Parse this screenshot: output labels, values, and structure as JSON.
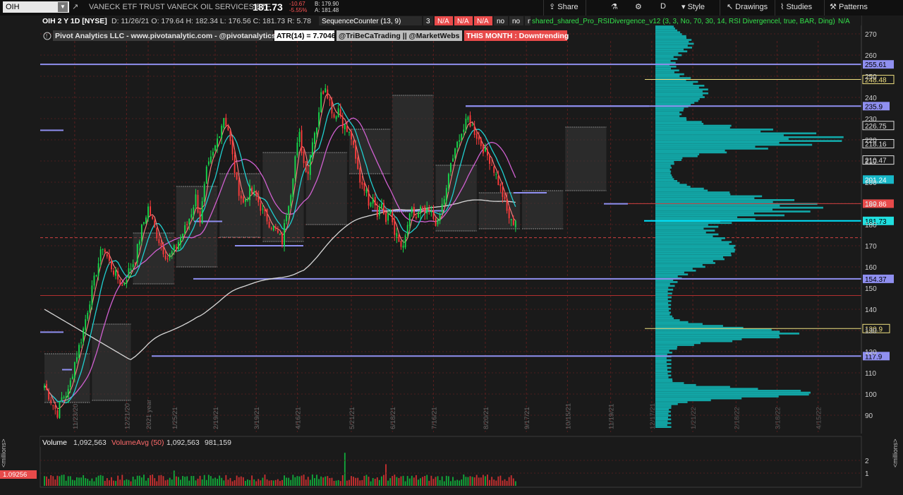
{
  "toolbar": {
    "symbol": "OIH",
    "description": "VANECK ETF TRUST VANECK OIL SERVICES ETF",
    "last": "181.73",
    "net_change": "-10.67",
    "pct_change": "-5.55%",
    "bid": "B: 179.90",
    "ask": "A: 181.48",
    "share": "Share",
    "period": "D",
    "style": "Style",
    "drawings": "Drawings",
    "studies": "Studies",
    "patterns": "Patterns",
    "icons": [
      "share-icon",
      "flask-icon",
      "gear-icon",
      "style-icon",
      "drawings-icon",
      "studies-icon",
      "patterns-icon"
    ]
  },
  "header": {
    "title": "OIH 2 Y 1D [NYSE]",
    "ohlc": [
      "D: 11/26/21",
      "O: 179.64",
      "H: 182.34",
      "L: 176.56",
      "C: 181.73",
      "R: 5.78"
    ],
    "seq": [
      "SequenceCounter (13, 9)",
      "3",
      "N/A",
      "N/A",
      "N/A",
      "no",
      "no",
      "no",
      "no"
    ],
    "rsi_study": "shared_shared_Pro_RSIDivergence_v12 (3, 3, No, 70, 30, 14, RSI Divergencel, true, BAR, Ding)",
    "rsi_value": "N/A",
    "pivot": "Pivot Analytics LLC - www.pivotanalytic.com - @pivotanalytics",
    "atr": "ATR(14) = 7.7046",
    "tribeca": "@TriBeCaTrading || @MarketWebs",
    "month": "THIS MONTH : Downtrending"
  },
  "volume_header": {
    "label": "Volume",
    "volume": "1,092,563",
    "avg_label": "VolumeAvg (50)",
    "avg": "1,092,563",
    "other": "981,159",
    "current_tag": "1.09256",
    "unit": "<millions>"
  },
  "colors": {
    "background": "#1a1a1a",
    "bull": "#17d94b",
    "bear": "#ff3b3b",
    "level": "#8f8ff0",
    "price_line": "#00e5ff",
    "profile": "#12a5a5",
    "sma200": "#d8d8d8",
    "ema_fast": "#ff8080",
    "ema_mid": "#20d0d0",
    "ema_slow": "#d060d0"
  },
  "chart_data": {
    "type": "candlestick",
    "ylim": [
      82,
      276
    ],
    "yticks": [
      90,
      100,
      110,
      120,
      130,
      140,
      150,
      160,
      170,
      180,
      190,
      200,
      210,
      220,
      230,
      240,
      250,
      260,
      270
    ],
    "x_tick_labels": [
      "11/23/20",
      "12/21/20",
      "2021 year",
      "1/25/21",
      "2/19/21",
      "3/19/21",
      "4/16/21",
      "5/21/21",
      "6/18/21",
      "7/16/21",
      "8/20/21",
      "9/17/21",
      "10/15/21",
      "11/19/21",
      "12/17/21",
      "1/21/22",
      "2/18/22",
      "3/18/22",
      "4/15/22"
    ],
    "x_tick_index": [
      14,
      38,
      48,
      60,
      79,
      98,
      117,
      142,
      161,
      180,
      204,
      223,
      242,
      262,
      281,
      300,
      320,
      339,
      358
    ],
    "n_bars": 264,
    "anchors": [
      [
        0,
        104
      ],
      [
        3,
        97
      ],
      [
        6,
        91
      ],
      [
        8,
        98
      ],
      [
        11,
        101
      ],
      [
        14,
        115
      ],
      [
        17,
        126
      ],
      [
        20,
        140
      ],
      [
        24,
        158
      ],
      [
        27,
        170
      ],
      [
        30,
        162
      ],
      [
        33,
        156
      ],
      [
        36,
        151
      ],
      [
        39,
        158
      ],
      [
        42,
        164
      ],
      [
        45,
        178
      ],
      [
        48,
        188
      ],
      [
        51,
        178
      ],
      [
        54,
        170
      ],
      [
        57,
        164
      ],
      [
        60,
        168
      ],
      [
        63,
        174
      ],
      [
        66,
        180
      ],
      [
        68,
        186
      ],
      [
        70,
        193
      ],
      [
        72,
        182
      ],
      [
        75,
        205
      ],
      [
        78,
        213
      ],
      [
        81,
        224
      ],
      [
        83,
        231
      ],
      [
        85,
        225
      ],
      [
        87,
        212
      ],
      [
        89,
        199
      ],
      [
        92,
        190
      ],
      [
        95,
        196
      ],
      [
        98,
        193
      ],
      [
        101,
        186
      ],
      [
        104,
        181
      ],
      [
        107,
        177
      ],
      [
        110,
        172
      ],
      [
        112,
        186
      ],
      [
        114,
        196
      ],
      [
        116,
        212
      ],
      [
        118,
        222
      ],
      [
        120,
        209
      ],
      [
        122,
        205
      ],
      [
        124,
        221
      ],
      [
        126,
        227
      ],
      [
        128,
        241
      ],
      [
        130,
        246
      ],
      [
        132,
        238
      ],
      [
        134,
        231
      ],
      [
        136,
        235
      ],
      [
        138,
        228
      ],
      [
        140,
        224
      ],
      [
        142,
        221
      ],
      [
        144,
        210
      ],
      [
        146,
        201
      ],
      [
        148,
        198
      ],
      [
        150,
        191
      ],
      [
        152,
        194
      ],
      [
        154,
        186
      ],
      [
        156,
        190
      ],
      [
        158,
        181
      ],
      [
        160,
        186
      ],
      [
        162,
        177
      ],
      [
        164,
        171
      ],
      [
        166,
        168
      ],
      [
        168,
        180
      ],
      [
        170,
        186
      ],
      [
        172,
        183
      ],
      [
        174,
        187
      ],
      [
        176,
        185
      ],
      [
        178,
        186
      ],
      [
        180,
        183
      ],
      [
        182,
        180
      ],
      [
        184,
        189
      ],
      [
        186,
        196
      ],
      [
        188,
        209
      ],
      [
        190,
        214
      ],
      [
        192,
        222
      ],
      [
        194,
        225
      ],
      [
        196,
        230
      ],
      [
        198,
        226
      ],
      [
        200,
        222
      ],
      [
        202,
        218
      ],
      [
        204,
        214
      ],
      [
        206,
        211
      ],
      [
        208,
        206
      ],
      [
        210,
        200
      ],
      [
        212,
        194
      ],
      [
        214,
        186
      ],
      [
        216,
        181
      ],
      [
        218,
        181.73
      ]
    ],
    "levels": [
      {
        "price": 255.61,
        "label": "255.61",
        "kind": "resistance"
      },
      {
        "price": 248.48,
        "label": "248.48",
        "kind": "marker"
      },
      {
        "price": 235.9,
        "label": "235.9",
        "kind": "resistance"
      },
      {
        "price": 226.75,
        "label": "226.75",
        "kind": "axis"
      },
      {
        "price": 218.16,
        "label": "218.16",
        "kind": "axis"
      },
      {
        "price": 210.47,
        "label": "210.47",
        "kind": "axis"
      },
      {
        "price": 201.24,
        "label": "201.24",
        "kind": "cyan"
      },
      {
        "price": 189.86,
        "label": "189.86",
        "kind": "red"
      },
      {
        "price": 181.73,
        "label": "181.73",
        "kind": "last"
      },
      {
        "price": 154.37,
        "label": "154.37",
        "kind": "resistance"
      },
      {
        "price": 130.9,
        "label": "130.9",
        "kind": "marker"
      },
      {
        "price": 117.9,
        "label": "117.9",
        "kind": "resistance"
      }
    ],
    "volume_ylim": [
      0,
      3
    ],
    "volume_yticks": [
      1,
      2
    ],
    "series_names": []
  }
}
